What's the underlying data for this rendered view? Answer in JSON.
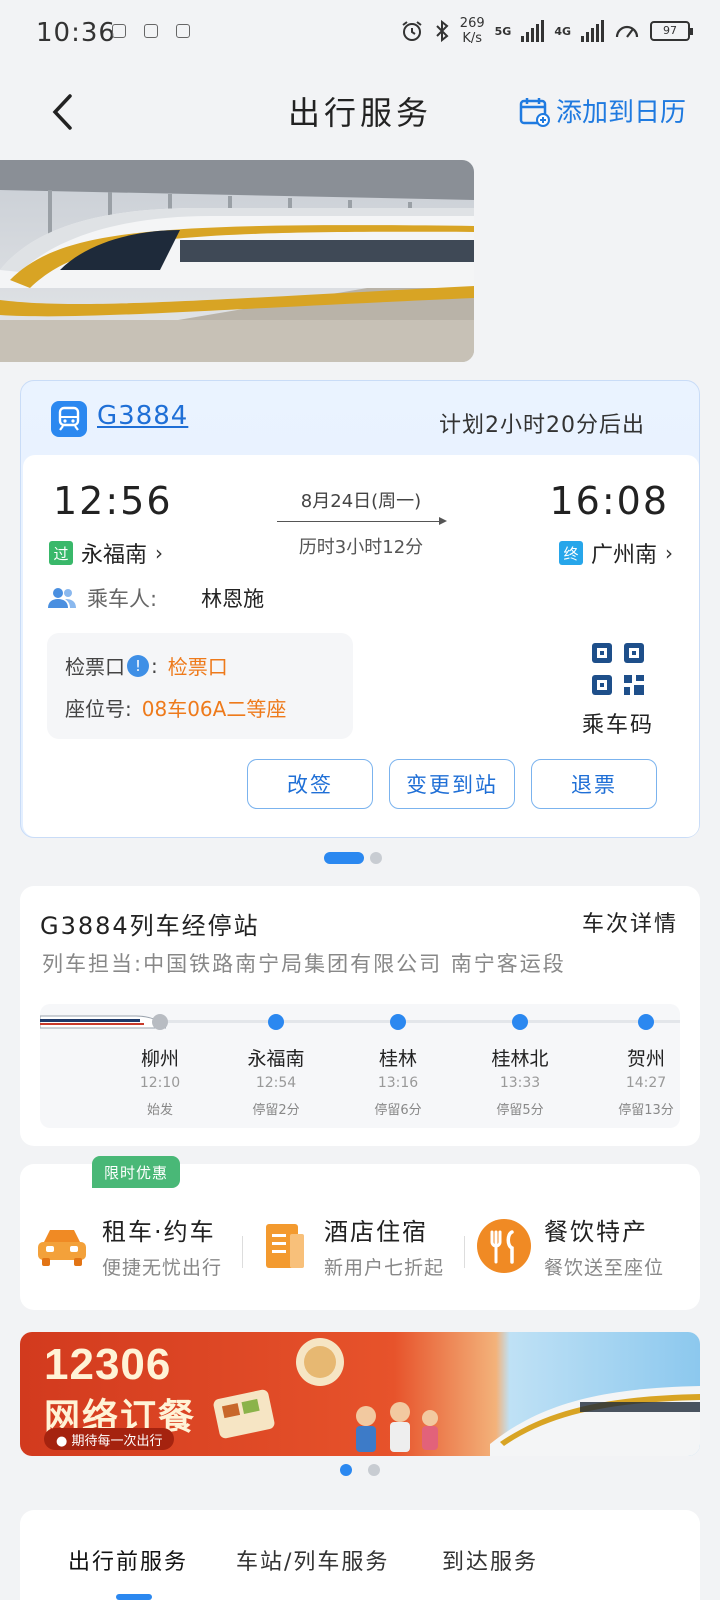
{
  "status_bar": {
    "time": "10:36",
    "speed_value": "269",
    "speed_unit": "K/s",
    "net1": "5G",
    "net2": "4G",
    "battery": "97"
  },
  "header": {
    "title": "出行服务",
    "add_calendar": "添加到日历"
  },
  "ticket": {
    "train_no": "G3884",
    "plan_text": "计划2小时20分后出",
    "dep_time": "12:56",
    "arr_time": "16:08",
    "date": "8月24日(周一)",
    "duration": "历时3小时12分",
    "dep_tag": "过",
    "dep_station": "永福南",
    "arr_tag": "终",
    "arr_station": "广州南",
    "passenger_label": "乘车人:",
    "passenger_name": "林恩施",
    "gate_label": "检票口",
    "gate_value": "检票口",
    "seat_label": "座位号:",
    "seat_value": "08车06A二等座",
    "qr_label": "乘车码",
    "buttons": [
      "改签",
      "变更到站",
      "退票"
    ]
  },
  "stops": {
    "title": "G3884列车经停站",
    "detail": "车次详情",
    "bureau": "列车担当:中国铁路南宁局集团有限公司 南宁客运段",
    "list": [
      {
        "name": "柳州",
        "time": "12:10",
        "stay": "始发"
      },
      {
        "name": "永福南",
        "time": "12:54",
        "stay": "停留2分"
      },
      {
        "name": "桂林",
        "time": "13:16",
        "stay": "停留6分"
      },
      {
        "name": "桂林北",
        "time": "13:33",
        "stay": "停留5分"
      },
      {
        "name": "贺州",
        "time": "14:27",
        "stay": "停留13分"
      }
    ]
  },
  "services": {
    "promo": "限时优惠",
    "items": [
      {
        "title": "租车·约车",
        "sub": "便捷无忧出行"
      },
      {
        "title": "酒店住宿",
        "sub": "新用户七折起"
      },
      {
        "title": "餐饮特产",
        "sub": "餐饮送至座位"
      }
    ]
  },
  "banner": {
    "number": "12306",
    "text": "网络订餐",
    "pill": "● 期待每一次出行"
  },
  "tabs": [
    "出行前服务",
    "车站/列车服务",
    "到达服务"
  ],
  "colors": {
    "accent": "#2b88f0",
    "orange": "#ee7a1b",
    "green": "#39b86a"
  }
}
